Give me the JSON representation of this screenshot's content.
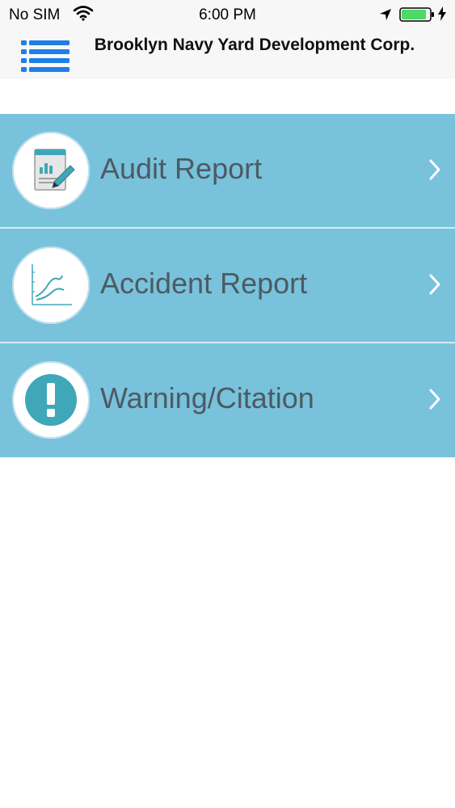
{
  "status_bar": {
    "carrier": "No SIM",
    "time": "6:00 PM",
    "icons": [
      "wifi-icon",
      "location-arrow-icon",
      "battery-icon",
      "charging-bolt-icon"
    ],
    "battery_color": "#4cd964"
  },
  "nav": {
    "menu_icon": "hamburger-list-icon",
    "title": "Brooklyn Navy Yard Development Corp.",
    "accent_color": "#1e7ee8"
  },
  "menu": {
    "row_color": "#78c2dc",
    "items": [
      {
        "label": "Audit Report",
        "icon": "audit-report-icon"
      },
      {
        "label": "Accident Report",
        "icon": "accident-chart-icon"
      },
      {
        "label": "Warning/Citation",
        "icon": "warning-exclamation-icon"
      }
    ]
  }
}
